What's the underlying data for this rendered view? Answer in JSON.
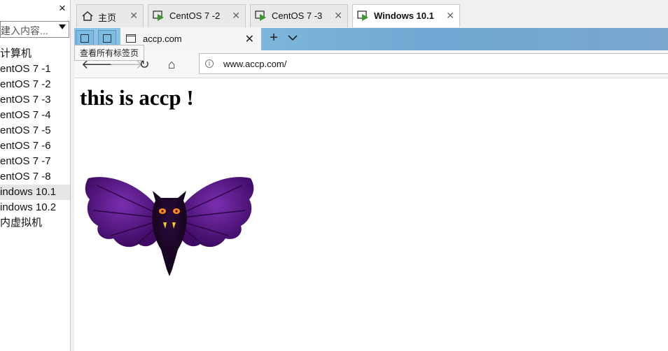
{
  "library": {
    "close_glyph": "×",
    "search_placeholder": "建入内容...",
    "items": [
      {
        "label": "计算机"
      },
      {
        "label": "entOS 7 -1"
      },
      {
        "label": "entOS 7 -2"
      },
      {
        "label": "entOS 7 -3"
      },
      {
        "label": "entOS 7 -4"
      },
      {
        "label": "entOS 7 -5"
      },
      {
        "label": "entOS 7 -6"
      },
      {
        "label": "entOS 7 -7"
      },
      {
        "label": "entOS 7 -8"
      },
      {
        "label": "indows 10.1",
        "selected": true
      },
      {
        "label": "indows 10.2"
      },
      {
        "label": "内虚拟机"
      }
    ]
  },
  "workstation_tabs": [
    {
      "label": "主页",
      "icon": "home-icon"
    },
    {
      "label": "CentOS 7 -2",
      "icon": "vm-running-icon"
    },
    {
      "label": "CentOS 7 -3",
      "icon": "vm-running-icon"
    },
    {
      "label": "Windows 10.1",
      "icon": "vm-running-icon",
      "active": true
    }
  ],
  "browser": {
    "tab_title": "accp.com",
    "tooltip": "查看所有标签页",
    "address": "www.accp.com/",
    "new_tab_glyph": "+",
    "close_glyph": "✕",
    "nav": {
      "back": "🡐",
      "forward": "🡒",
      "refresh": "↻",
      "home": "⌂"
    },
    "page": {
      "heading": "this is accp !"
    }
  },
  "colors": {
    "edge_tabbar": "#7fb5dc",
    "bat_purple": "#4b0f73",
    "vm_green": "#3b9a2e"
  }
}
